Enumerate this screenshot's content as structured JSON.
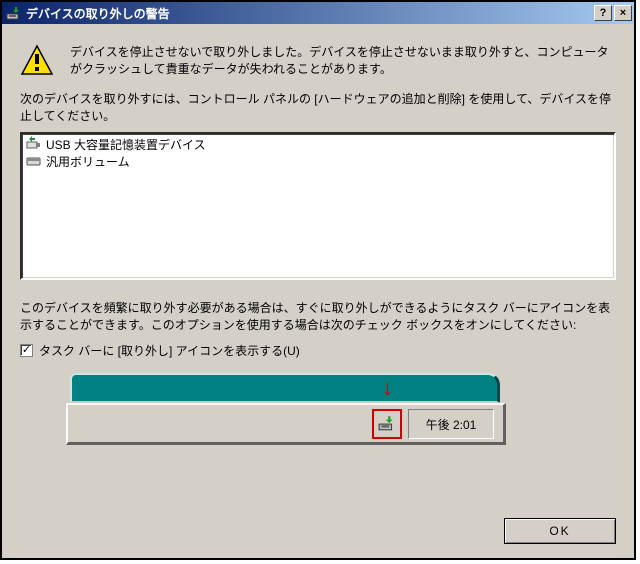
{
  "titlebar": {
    "icon": "eject-device-icon",
    "title": "デバイスの取り外しの警告",
    "help_label": "?",
    "close_label": "×"
  },
  "warning": {
    "message": "デバイスを停止させないで取り外しました。デバイスを停止させないまま取り外すと、コンピュータがクラッシュして貴重なデータが失われることがあります。"
  },
  "instruction": "次のデバイスを取り外すには、コントロール パネルの [ハードウェアの追加と削除] を使用して、デバイスを停止してください。",
  "devices": [
    {
      "icon": "usb-device-icon",
      "label": "USB 大容量記憶装置デバイス"
    },
    {
      "icon": "volume-icon",
      "label": "汎用ボリューム"
    }
  ],
  "note": "このデバイスを頻繁に取り外す必要がある場合は、すぐに取り外しができるようにタスク バーにアイコンを表示することができます。このオプションを使用する場合は次のチェック ボックスをオンにしてください:",
  "checkbox": {
    "checked": true,
    "label": "タスク バーに [取り外し] アイコンを表示する(U)"
  },
  "tray": {
    "clock": "午後 2:01",
    "highlight_icon": "eject-device-icon"
  },
  "buttons": {
    "ok": "OK"
  },
  "colors": {
    "titlebar_start": "#0a246a",
    "titlebar_end": "#a6caf0",
    "face": "#d4d0c8",
    "teal": "#008080",
    "highlight_red": "#d40000"
  }
}
